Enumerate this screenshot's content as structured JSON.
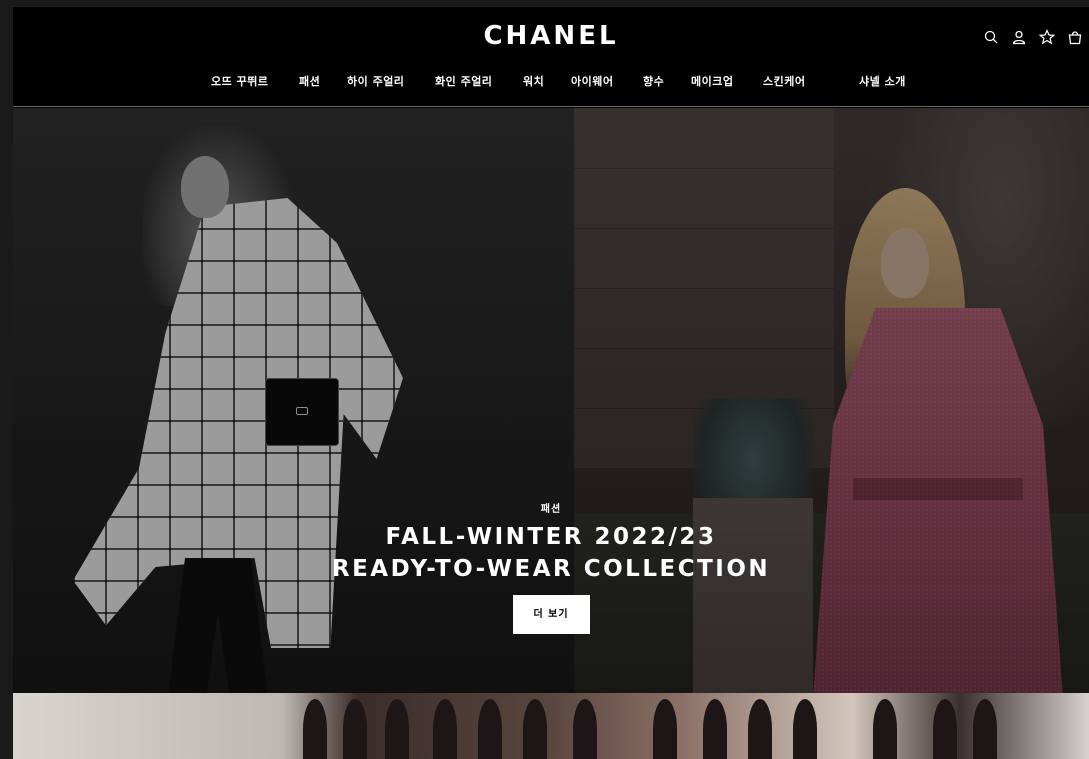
{
  "brand": {
    "logo_text": "CHANEL"
  },
  "utility_icons": [
    "search-icon",
    "account-icon",
    "wishlist-star-icon",
    "shopping-bag-icon"
  ],
  "nav": {
    "items": [
      {
        "label": "오뜨 꾸뛰르"
      },
      {
        "label": "패션"
      },
      {
        "label": "하이 주얼리"
      },
      {
        "label": "화인 주얼리"
      },
      {
        "label": "워치"
      },
      {
        "label": "아이웨어"
      },
      {
        "label": "향수"
      },
      {
        "label": "메이크업"
      },
      {
        "label": "스킨케어"
      },
      {
        "label": "샤넬 소개"
      }
    ]
  },
  "hero": {
    "category": "패션",
    "title_line1": "FALL-WINTER 2022/23",
    "title_line2": "READY-TO-WEAR COLLECTION",
    "cta_label": "더 보기"
  },
  "colors": {
    "background": "#000000",
    "text": "#ffffff",
    "button_bg": "#ffffff",
    "button_text": "#000000"
  }
}
